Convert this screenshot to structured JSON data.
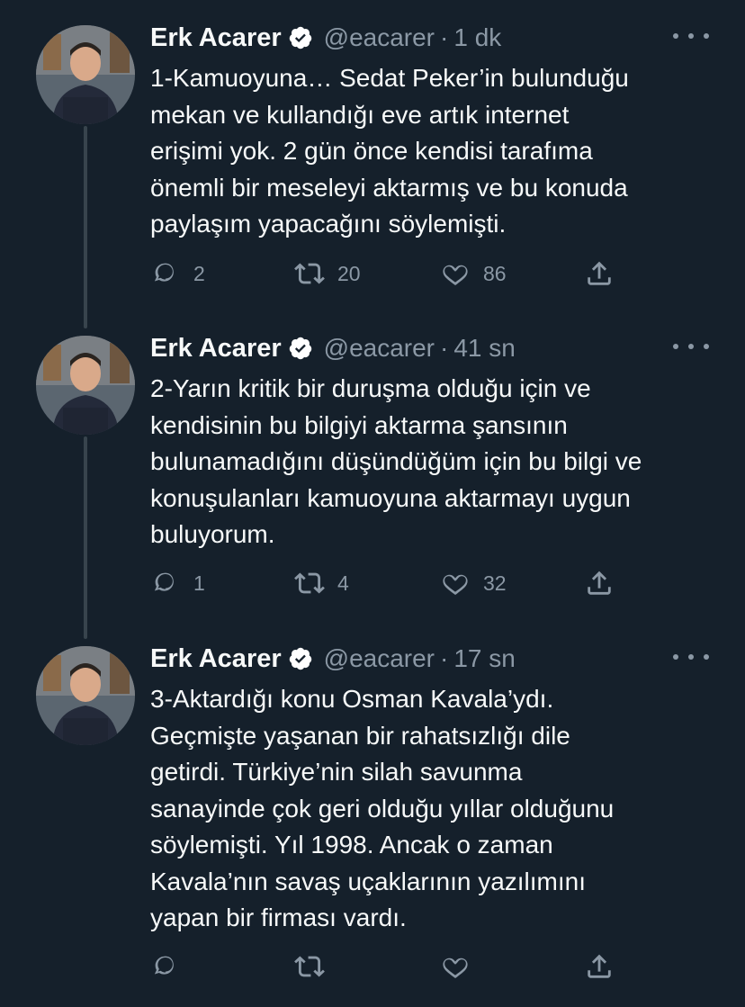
{
  "tweets": [
    {
      "name": "Erk Acarer",
      "handle": "@eacarer",
      "separator": "·",
      "time": "1 dk",
      "text": "1-Kamuoyuna… Sedat Peker’in bulunduğu\nmekan ve kullandığı eve artık internet\nerişimi yok. 2 gün önce kendisi tarafıma\nönemli bir meseleyi aktarmış ve bu konuda\npaylaşım yapacağını söylemişti.",
      "replies": "2",
      "retweets": "20",
      "likes": "86"
    },
    {
      "name": "Erk Acarer",
      "handle": "@eacarer",
      "separator": "·",
      "time": "41 sn",
      "text": "2-Yarın kritik bir duruşma olduğu için ve\nkendisinin bu bilgiyi aktarma şansının\nbulunamadığını düşündüğüm için bu bilgi ve\nkonuşulanları kamuoyuna aktarmayı uygun\nbuluyorum.",
      "replies": "1",
      "retweets": "4",
      "likes": "32"
    },
    {
      "name": "Erk Acarer",
      "handle": "@eacarer",
      "separator": "·",
      "time": "17 sn",
      "text": "3-Aktardığı konu Osman Kavala’ydı.\nGeçmişte yaşanan bir rahatsızlığı dile\ngetirdi. Türkiye’nin silah savunma\nsanayinde çok geri olduğu yıllar olduğunu\nsöylemişti. Yıl 1998. Ancak o zaman\nKavala’nın savaş uçaklarının yazılımını\nyapan bir firması vardı.",
      "replies": "",
      "retweets": "",
      "likes": ""
    }
  ],
  "colors": {
    "background": "#15202b",
    "text": "#f7f9f9",
    "secondary": "#8b98a5",
    "thread_line": "#38444d",
    "verified_badge": "#ffffff"
  },
  "icons": {
    "reply": "reply-icon",
    "retweet": "retweet-icon",
    "like": "heart-icon",
    "share": "share-icon",
    "more": "more-icon",
    "verified": "verified-badge-icon"
  }
}
